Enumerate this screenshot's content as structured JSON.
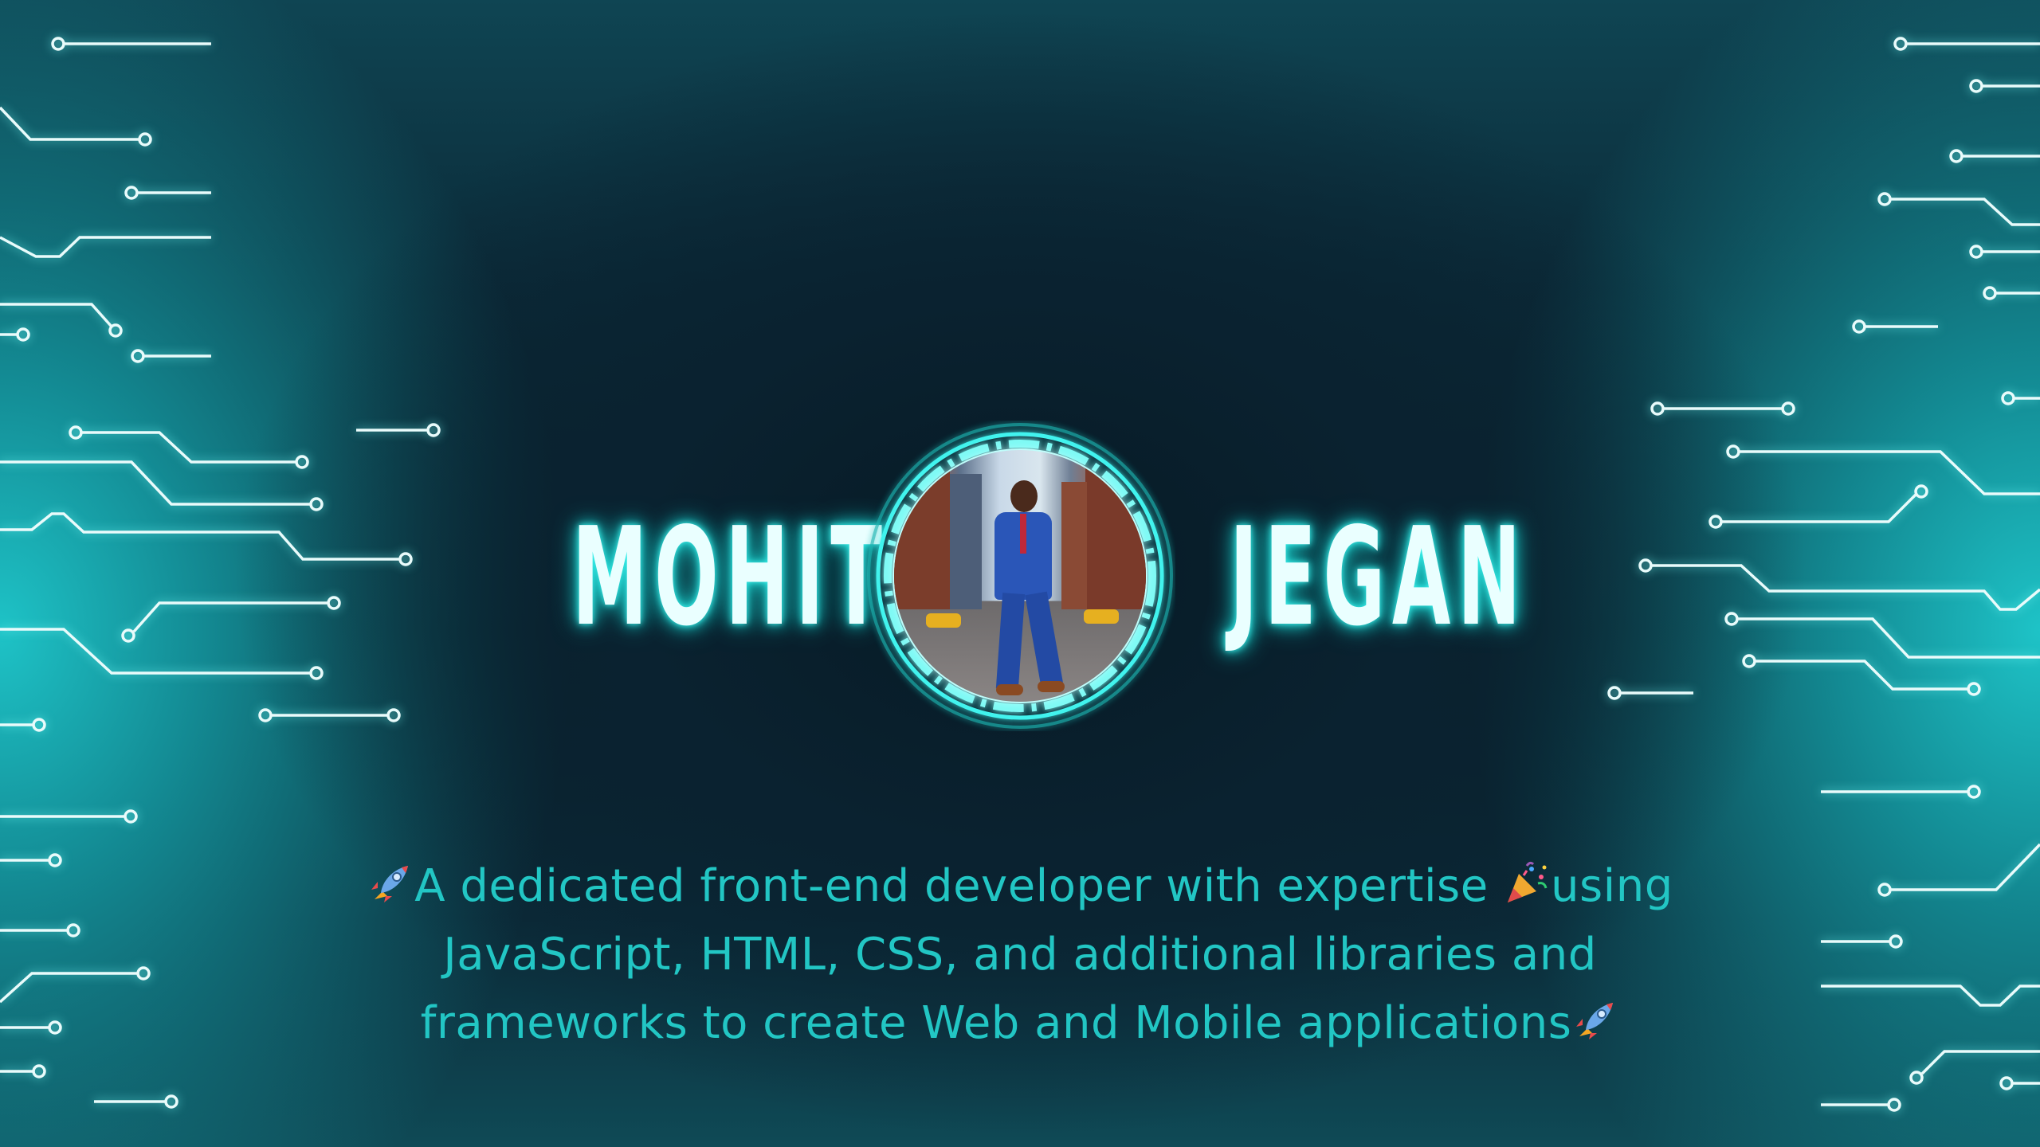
{
  "name": {
    "first": "MOHITH",
    "last": "JEGAN"
  },
  "bio": {
    "line1_pre": "A dedicated front-end developer with expertise ",
    "line1_post": "using",
    "line2": "JavaScript, HTML, CSS, and additional libraries and",
    "line3": "frameworks to create Web and Mobile applications"
  },
  "icons": {
    "lead": "rocket-icon",
    "mid": "party-popper-icon",
    "trail": "rocket-icon"
  },
  "colors": {
    "accent": "#22c6c4",
    "glow": "#3ff3ee",
    "background": "#081d28"
  }
}
